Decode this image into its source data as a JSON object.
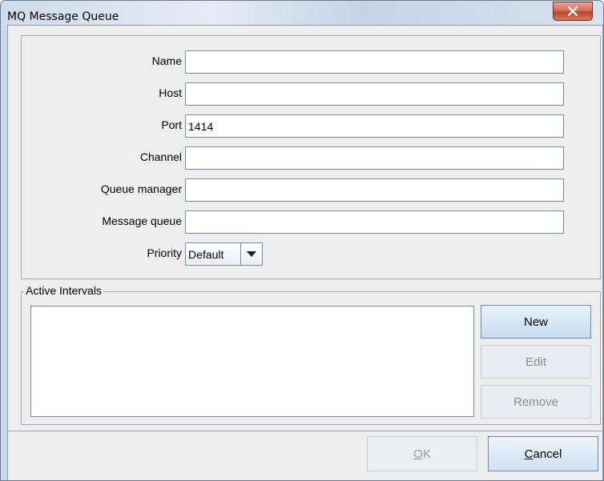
{
  "window": {
    "title": "MQ Message Queue",
    "close_label": "X"
  },
  "form": {
    "name": {
      "label": "Name",
      "value": ""
    },
    "host": {
      "label": "Host",
      "value": ""
    },
    "port": {
      "label": "Port",
      "value": "1414"
    },
    "channel": {
      "label": "Channel",
      "value": ""
    },
    "queue_manager": {
      "label": "Queue manager",
      "value": ""
    },
    "message_queue": {
      "label": "Message queue",
      "value": ""
    },
    "priority": {
      "label": "Priority",
      "value": "Default"
    }
  },
  "intervals": {
    "legend": "Active Intervals",
    "items": [],
    "new_label": "New",
    "edit_label": "Edit",
    "remove_label": "Remove"
  },
  "footer": {
    "ok_mnemonic": "O",
    "ok_rest": "K",
    "cancel_mnemonic": "C",
    "cancel_rest": "ancel"
  },
  "colors": {
    "close_button": "#c0432a",
    "disabled_text": "#8c8c8c"
  }
}
